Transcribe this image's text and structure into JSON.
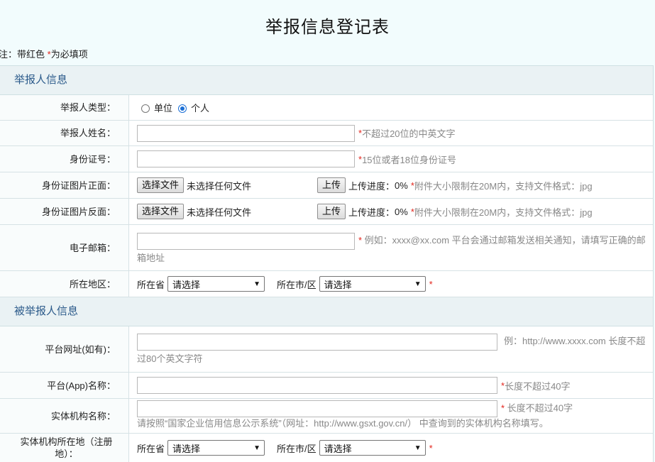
{
  "title": "举报信息登记表",
  "note": {
    "prefix": "注：带红色 ",
    "star": "*",
    "suffix": "为必填项"
  },
  "required_mark": "*",
  "reporter_section": {
    "heading": "举报人信息",
    "type": {
      "label": "举报人类型：",
      "option_org": "单位",
      "option_person": "个人",
      "selected": "个人"
    },
    "name": {
      "label": "举报人姓名：",
      "value": "",
      "hint": " 不超过20位的中英文字"
    },
    "id_number": {
      "label": "身份证号：",
      "value": "",
      "hint": " 15位或者18位身份证号"
    },
    "id_front": {
      "label": "身份证图片正面：",
      "choose_label": "选择文件",
      "no_file": "未选择任何文件",
      "upload_label": "上传",
      "progress_label": "上传进度：",
      "progress": "0%",
      "hint": " 附件大小限制在20M内，支持文件格式：jpg"
    },
    "id_back": {
      "label": "身份证图片反面：",
      "choose_label": "选择文件",
      "no_file": "未选择任何文件",
      "upload_label": "上传",
      "progress_label": "上传进度：",
      "progress": "0%",
      "hint": " 附件大小限制在20M内，支持文件格式：jpg"
    },
    "email": {
      "label": "电子邮箱：",
      "value": "",
      "hint": "   例如：xxxx@xx.com 平台会通过邮箱发送相关通知，请填写正确的邮箱地址"
    },
    "region": {
      "label": "所在地区：",
      "province_label": "所在省",
      "province_value": "请选择",
      "city_label": "所在市/区",
      "city_value": "请选择"
    }
  },
  "reported_section": {
    "heading": "被举报人信息",
    "platform_url": {
      "label": "平台网址(如有)：",
      "value": "",
      "hint": "例：http://www.xxxx.com 长度不超过80个英文字符"
    },
    "platform_name": {
      "label": "平台(App)名称：",
      "value": "",
      "hint": " 长度不超过40字"
    },
    "entity_name": {
      "label": "实体机构名称：",
      "value": "",
      "hint": " 长度不超过40字",
      "hint2": "请按照“国家企业信用信息公示系统”（网址：http://www.gsxt.gov.cn/） 中查询到的实体机构名称填写。"
    },
    "entity_location": {
      "label": "实体机构所在地（注册地）：",
      "province_label": "所在省",
      "province_value": "请选择",
      "city_label": "所在市/区",
      "city_value": "请选择"
    }
  }
}
